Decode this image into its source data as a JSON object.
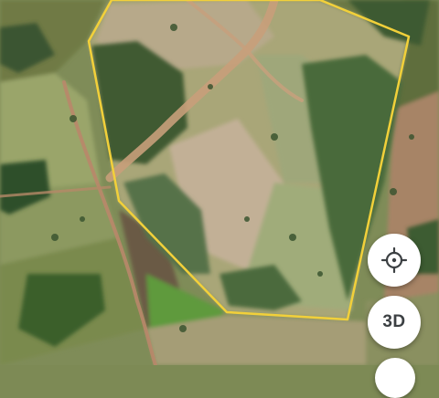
{
  "map": {
    "type": "satellite",
    "boundary_color": "#f2d03a"
  },
  "controls": {
    "locate": {
      "icon": "crosshair-icon"
    },
    "view_3d": {
      "label": "3D"
    },
    "partial_button": {
      "icon": "layers-icon"
    }
  }
}
